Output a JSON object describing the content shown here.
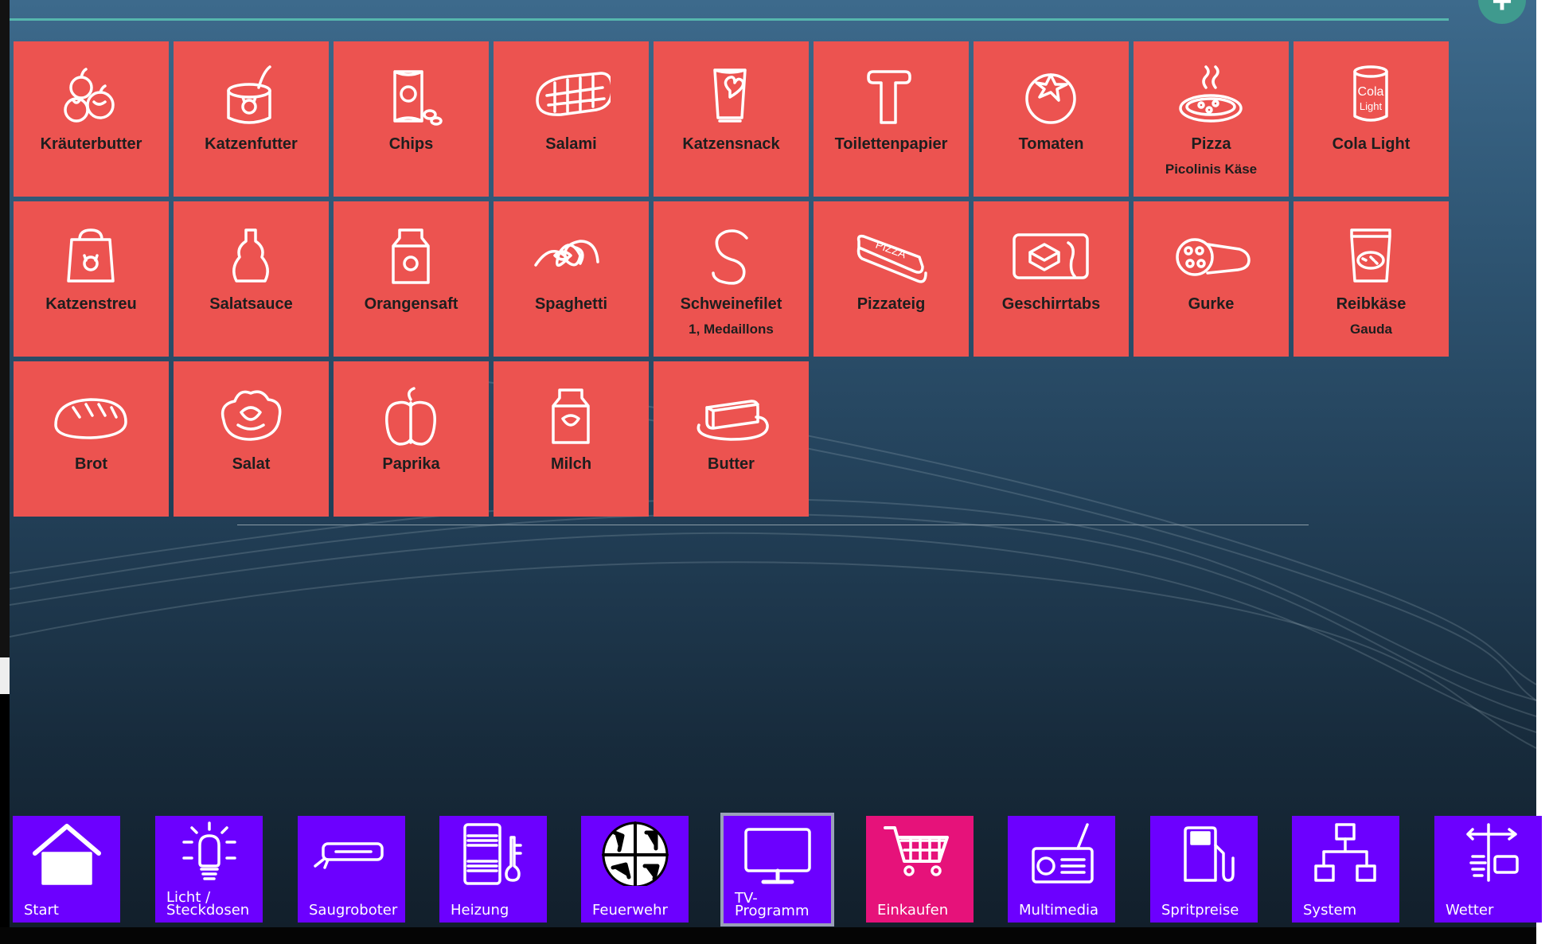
{
  "colors": {
    "tile": "#ec5350",
    "nav": "#6c00ff",
    "nav_active_pink": "#e6127a",
    "accent_line": "#56b7ad"
  },
  "add_button_icon": "plus-icon",
  "items": [
    {
      "name": "Kräuterbutter",
      "sub": "",
      "icon": "garlic-icon"
    },
    {
      "name": "Katzenfutter",
      "sub": "",
      "icon": "cat-food-can-icon"
    },
    {
      "name": "Chips",
      "sub": "",
      "icon": "chips-bag-icon"
    },
    {
      "name": "Salami",
      "sub": "",
      "icon": "salami-icon"
    },
    {
      "name": "Katzensnack",
      "sub": "",
      "icon": "snack-bag-icon"
    },
    {
      "name": "Toilettenpapier",
      "sub": "",
      "icon": "toilet-paper-icon"
    },
    {
      "name": "Tomaten",
      "sub": "",
      "icon": "tomato-icon"
    },
    {
      "name": "Pizza",
      "sub": "Picolinis Käse",
      "icon": "pizza-icon"
    },
    {
      "name": "Cola Light",
      "sub": "",
      "icon": "cola-can-icon"
    },
    {
      "name": "Katzenstreu",
      "sub": "",
      "icon": "litter-bag-icon"
    },
    {
      "name": "Salatsauce",
      "sub": "",
      "icon": "sauce-bottle-icon"
    },
    {
      "name": "Orangensaft",
      "sub": "",
      "icon": "juice-carton-icon"
    },
    {
      "name": "Spaghetti",
      "sub": "",
      "icon": "spaghetti-icon"
    },
    {
      "name": "Schweinefilet",
      "sub": "1, Medaillons",
      "icon": "letter-s-icon"
    },
    {
      "name": "Pizzateig",
      "sub": "",
      "icon": "pizza-dough-icon"
    },
    {
      "name": "Geschirrtabs",
      "sub": "",
      "icon": "dishwasher-tabs-icon"
    },
    {
      "name": "Gurke",
      "sub": "",
      "icon": "cucumber-icon"
    },
    {
      "name": "Reibkäse",
      "sub": "Gauda",
      "icon": "cheese-bag-icon"
    },
    {
      "name": "Brot",
      "sub": "",
      "icon": "bread-icon"
    },
    {
      "name": "Salat",
      "sub": "",
      "icon": "lettuce-icon"
    },
    {
      "name": "Paprika",
      "sub": "",
      "icon": "pepper-icon"
    },
    {
      "name": "Milch",
      "sub": "",
      "icon": "milk-carton-icon"
    },
    {
      "name": "Butter",
      "sub": "",
      "icon": "butter-icon"
    }
  ],
  "nav": [
    {
      "id": "start",
      "label": "Start",
      "icon": "house-icon",
      "state": "normal"
    },
    {
      "id": "licht",
      "label": "Licht / Steckdosen",
      "icon": "bulb-icon",
      "state": "normal"
    },
    {
      "id": "saugroboter",
      "label": "Saugroboter",
      "icon": "robot-vacuum-icon",
      "state": "normal"
    },
    {
      "id": "heizung",
      "label": "Heizung",
      "icon": "radiator-icon",
      "state": "normal"
    },
    {
      "id": "feuerwehr",
      "label": "Feuerwehr",
      "icon": "firefighter-emblem-icon",
      "state": "normal"
    },
    {
      "id": "tv",
      "label": "TV-Programm",
      "icon": "tv-icon",
      "state": "focused"
    },
    {
      "id": "einkaufen",
      "label": "Einkaufen",
      "icon": "cart-icon",
      "state": "selected"
    },
    {
      "id": "multimedia",
      "label": "Multimedia",
      "icon": "radio-icon",
      "state": "normal"
    },
    {
      "id": "spritpreise",
      "label": "Spritpreise",
      "icon": "fuel-pump-icon",
      "state": "normal"
    },
    {
      "id": "system",
      "label": "System",
      "icon": "network-icon",
      "state": "normal"
    },
    {
      "id": "wetter",
      "label": "Wetter",
      "icon": "weather-vane-icon",
      "state": "normal"
    }
  ]
}
